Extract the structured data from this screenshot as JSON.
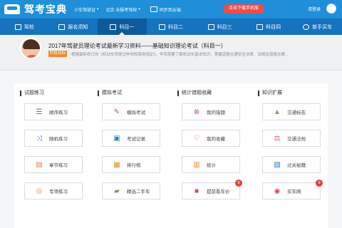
{
  "topbar": {
    "app_title": "驾考宝典",
    "car_type": "小车驾驶证",
    "location": "北京 未报考驾校",
    "sync_label": "同步到云端",
    "download_label": "点击下载手机版",
    "login_label": "请登录"
  },
  "nav": [
    {
      "label": "驾校",
      "icon": "school-icon"
    },
    {
      "label": "报名须知",
      "icon": "document-icon"
    },
    {
      "label": "科目一",
      "icon": "book-icon",
      "active": true
    },
    {
      "label": "科目二",
      "icon": "cone-icon"
    },
    {
      "label": "科目三",
      "icon": "car-icon"
    },
    {
      "label": "科目四",
      "icon": "book-icon"
    },
    {
      "label": "新手买车",
      "icon": "steering-wheel-icon"
    }
  ],
  "banner": {
    "headline": "2017年驾驶员理论考试最新学习资料——基础知识理论考试（科目一）",
    "stage_tag": "阶段目标",
    "description": "根据最新修订的《机动车驾驶证申领和使用规定》，学员需要了解机动车基本知识，掌握道路交通安全法律、法规及道路交通..."
  },
  "sections": [
    {
      "title": "试题练习",
      "items": [
        {
          "label": "顺序练习",
          "icon": "list-order-icon"
        },
        {
          "label": "随机练习",
          "icon": "shuffle-icon"
        },
        {
          "label": "章节练习",
          "icon": "chapter-icon"
        },
        {
          "label": "专项练习",
          "icon": "target-icon"
        }
      ]
    },
    {
      "title": "模拟考试",
      "items": [
        {
          "label": "模拟考试",
          "icon": "exam-pen-icon"
        },
        {
          "label": "考试记录",
          "icon": "record-icon"
        },
        {
          "label": "排行榜",
          "icon": "ranking-icon"
        },
        {
          "label": "精选二手车",
          "icon": "used-car-icon"
        }
      ]
    },
    {
      "title": "统计错题收藏",
      "items": [
        {
          "label": "我的错题",
          "icon": "wrong-x-icon"
        },
        {
          "label": "我的收藏",
          "icon": "heart-icon"
        },
        {
          "label": "统计",
          "icon": "bar-chart-icon"
        },
        {
          "label": "提前看车价",
          "icon": "car-price-icon",
          "badge": "8"
        }
      ]
    },
    {
      "title": "知识扩展",
      "items": [
        {
          "label": "交通标志",
          "icon": "traffic-sign-icon"
        },
        {
          "label": "交通法规",
          "icon": "law-scale-icon"
        },
        {
          "label": "过关秘籍",
          "icon": "secret-book-icon"
        },
        {
          "label": "买车网",
          "icon": "buy-car-icon",
          "badge": "9"
        }
      ]
    }
  ]
}
